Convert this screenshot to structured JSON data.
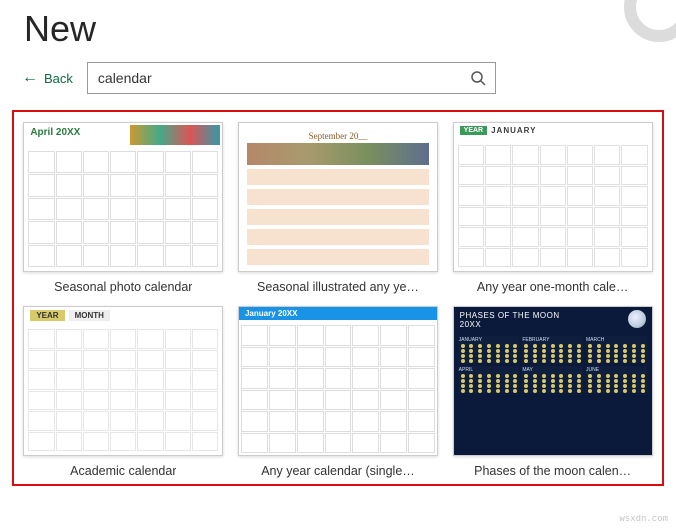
{
  "page": {
    "title": "New"
  },
  "nav": {
    "back_label": "Back"
  },
  "search": {
    "value": "calendar",
    "placeholder": ""
  },
  "templates": [
    {
      "label": "Seasonal photo calendar",
      "thumb": {
        "month_text": "April 20XX"
      }
    },
    {
      "label": "Seasonal illustrated any ye…",
      "thumb": {
        "month_text": "September 20__"
      }
    },
    {
      "label": "Any year one-month cale…",
      "thumb": {
        "year_text": "YEAR",
        "month_text": "JANUARY"
      }
    },
    {
      "label": "Academic calendar",
      "thumb": {
        "year_text": "YEAR",
        "month_text": "MONTH"
      }
    },
    {
      "label": "Any year calendar (single…",
      "thumb": {
        "month_text": "January 20XX"
      }
    },
    {
      "label": "Phases of the moon calen…",
      "thumb": {
        "title_text": "PHASES OF THE MOON",
        "year_text": "20XX",
        "months": [
          "JANUARY",
          "FEBRUARY",
          "MARCH",
          "APRIL",
          "MAY",
          "JUNE"
        ]
      }
    }
  ],
  "watermark": "wsxdn.com"
}
